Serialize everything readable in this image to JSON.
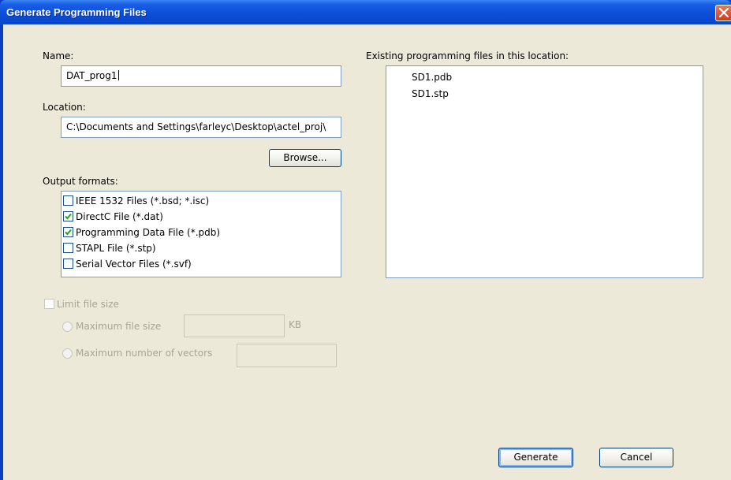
{
  "window": {
    "title": "Generate Programming Files"
  },
  "name_label": "Name:",
  "name_value": "DAT_prog1",
  "location_label": "Location:",
  "location_value": "C:\\Documents and Settings\\farleyc\\Desktop\\actel_proj\\",
  "browse_label": "Browse...",
  "output_formats_label": "Output formats:",
  "output_formats": [
    {
      "label": "IEEE 1532 Files (*.bsd; *.isc)",
      "checked": false
    },
    {
      "label": "DirectC File (*.dat)",
      "checked": true
    },
    {
      "label": "Programming Data File (*.pdb)",
      "checked": true
    },
    {
      "label": "STAPL File (*.stp)",
      "checked": false
    },
    {
      "label": "Serial Vector Files (*.svf)",
      "checked": false
    }
  ],
  "existing_label": "Existing programming files in this location:",
  "existing_files": [
    "SD1.pdb",
    "SD1.stp"
  ],
  "limit": {
    "label": "Limit file size",
    "max_size_label": "Maximum file size",
    "unit": "KB",
    "max_vectors_label": "Maximum number of vectors"
  },
  "buttons": {
    "generate": "Generate",
    "cancel": "Cancel"
  },
  "colors": {
    "titlebar": "#0b4ed8",
    "client": "#ece9d8",
    "check": "#21a121",
    "close": "#cc3d1b"
  }
}
